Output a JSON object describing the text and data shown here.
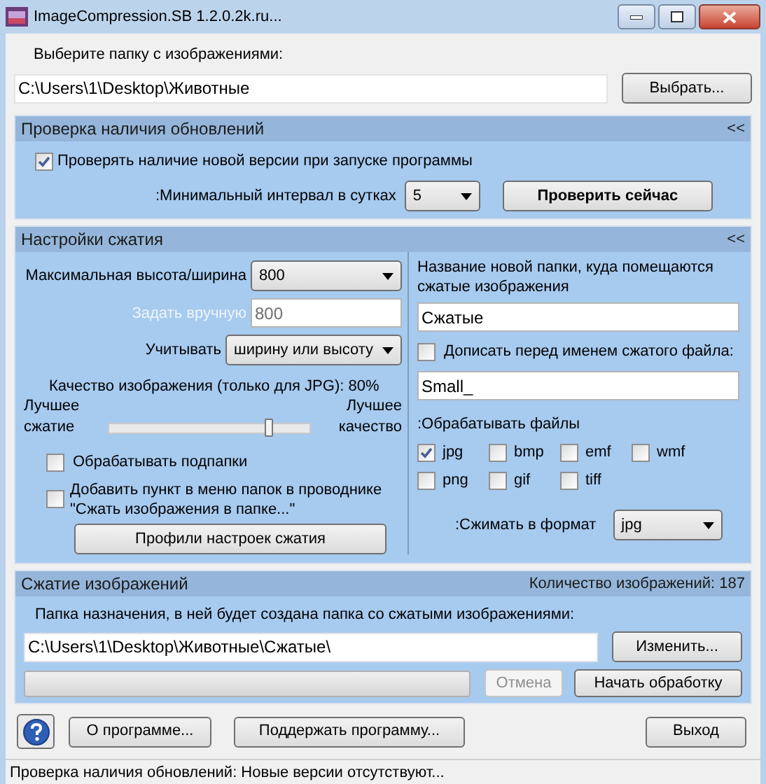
{
  "window": {
    "title": "ImageCompression.SB 1.2.0.2k.ru..."
  },
  "folder": {
    "label": "Выберите папку с изображениями:",
    "value": "C:\\Users\\1\\Desktop\\Животные",
    "button": "Выбрать..."
  },
  "updates": {
    "title": "Проверка наличия обновлений",
    "collapse": "<<",
    "check": {
      "label": "Проверять наличие новой версии при запуске программы",
      "checked": true
    },
    "interval": {
      "label": ":Минимальный интервал в сутках",
      "value": "5"
    },
    "check_now": "Проверить сейчас"
  },
  "compression": {
    "title": "Настройки сжатия",
    "collapse": "<<",
    "max_size": {
      "label": "Максимальная высота/ширина",
      "value": "800"
    },
    "manual": {
      "label": "Задать вручную",
      "value": "800",
      "disabled": true
    },
    "consider": {
      "label": "Учитывать",
      "value": "ширину или высоту"
    },
    "quality": {
      "label": "Качество изображения (только для JPG): 80%",
      "left": [
        "Лучшее",
        "сжатие"
      ],
      "right": [
        "Лучшее",
        "качество"
      ],
      "level": 0.8
    },
    "subfolders": {
      "label": "Обрабатывать подпапки",
      "checked": false
    },
    "context_menu": {
      "lines": [
        "Добавить пункт в меню папок в проводнике",
        "\"Сжать изображения в папке...\""
      ],
      "checked": false
    },
    "profiles": "Профили настроек сжатия",
    "folder_name": {
      "label": "Название новой папки, куда помещаются сжатые изображения",
      "value": "Сжатые"
    },
    "prefix": {
      "label": "Дописать перед именем сжатого файла:",
      "checked": false,
      "value": "Small_"
    },
    "file_types": {
      "label": ":Обрабатывать файлы",
      "items": [
        {
          "label": "jpg",
          "checked": true
        },
        {
          "label": "bmp",
          "checked": false
        },
        {
          "label": "emf",
          "checked": false
        },
        {
          "label": "wmf",
          "checked": false
        },
        {
          "label": "png",
          "checked": false
        },
        {
          "label": "gif",
          "checked": false
        },
        {
          "label": "tiff",
          "checked": false
        }
      ]
    },
    "format": {
      "label": ":Сжимать в формат",
      "value": "jpg"
    }
  },
  "processing": {
    "title": "Сжатие изображений",
    "count": "Количество изображений: 187",
    "dest_label": "Папка назначения, в ней будет создана папка со сжатыми изображениями:",
    "dest_value": "C:\\Users\\1\\Desktop\\Животные\\Сжатые\\",
    "change": "Изменить...",
    "level": 0,
    "cancel": {
      "label": "Отмена",
      "disabled": true
    },
    "start": "Начать обработку"
  },
  "buttons": {
    "about": "О программе...",
    "support": "Поддержать программу...",
    "exit": "Выход"
  },
  "status": "Проверка наличия обновлений: Новые версии отсутствуют..."
}
